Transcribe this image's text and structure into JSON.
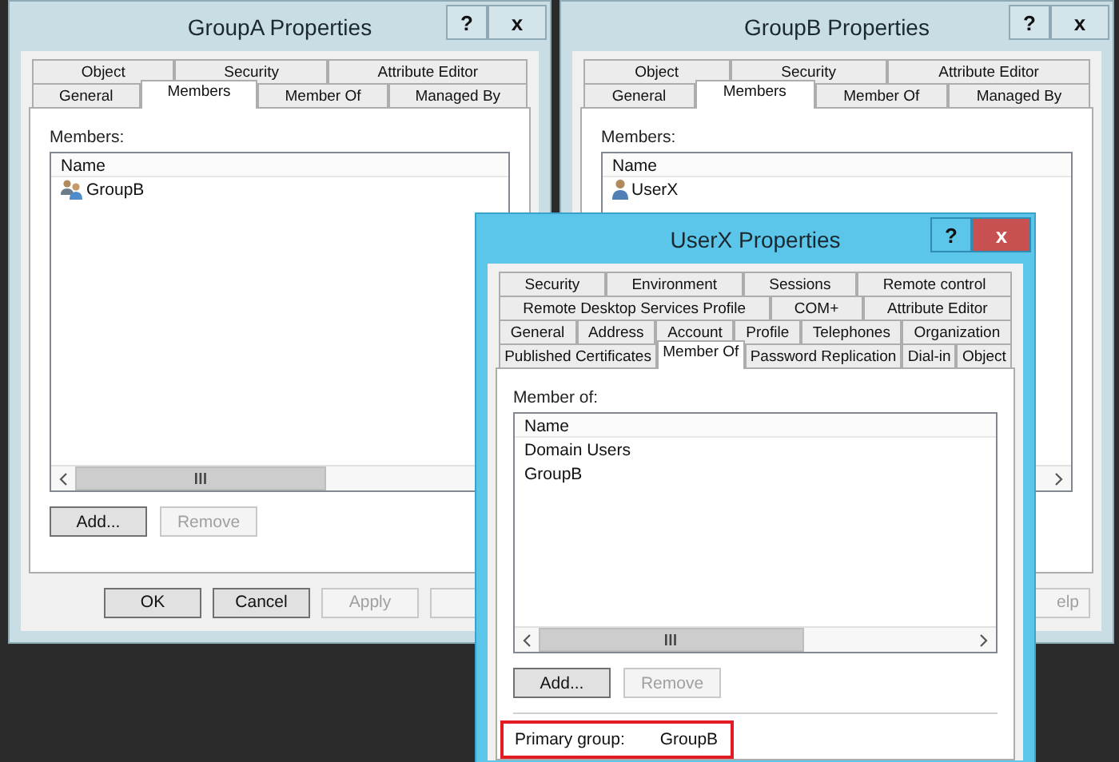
{
  "windows": [
    {
      "title": "GroupA Properties",
      "active": false,
      "caption_buttons": [
        "?",
        "x"
      ],
      "tab_rows": [
        {
          "tabs": [
            {
              "label": "Object",
              "selected": false
            },
            {
              "label": "Security",
              "selected": false
            },
            {
              "label": "Attribute Editor",
              "selected": false
            }
          ]
        },
        {
          "tabs": [
            {
              "label": "General",
              "selected": false
            },
            {
              "label": "Members",
              "selected": true
            },
            {
              "label": "Member Of",
              "selected": false
            },
            {
              "label": "Managed By",
              "selected": false
            }
          ]
        }
      ],
      "list_label": "Members:",
      "list_header": "Name",
      "list_items": [
        {
          "text": "GroupB",
          "kind": "group"
        }
      ],
      "list_buttons": [
        {
          "label": "Add...",
          "disabled": false
        },
        {
          "label": "Remove",
          "disabled": true
        }
      ],
      "footer_buttons": [
        {
          "label": "OK",
          "disabled": false
        },
        {
          "label": "Cancel",
          "disabled": false
        },
        {
          "label": "Apply",
          "disabled": true
        },
        {
          "disabled": true
        }
      ]
    },
    {
      "title": "GroupB Properties",
      "active": false,
      "caption_buttons": [
        "?",
        "x"
      ],
      "tab_rows": [
        {
          "tabs": [
            {
              "label": "Object",
              "selected": false
            },
            {
              "label": "Security",
              "selected": false
            },
            {
              "label": "Attribute Editor",
              "selected": false
            }
          ]
        },
        {
          "tabs": [
            {
              "label": "General",
              "selected": false
            },
            {
              "label": "Members",
              "selected": true
            },
            {
              "label": "Member Of",
              "selected": false
            },
            {
              "label": "Managed By",
              "selected": false
            }
          ]
        }
      ],
      "list_label": "Members:",
      "list_header": "Name",
      "list_items": [
        {
          "text": "UserX",
          "kind": "user"
        }
      ],
      "footer_buttons": [
        {
          "label": "elp",
          "disabled": true
        }
      ]
    },
    {
      "title": "UserX Properties",
      "active": true,
      "caption_buttons": [
        "?",
        "x"
      ],
      "tab_rows": [
        {
          "tabs": [
            {
              "label": "Security",
              "selected": false
            },
            {
              "label": "Environment",
              "selected": false
            },
            {
              "label": "Sessions",
              "selected": false
            },
            {
              "label": "Remote control",
              "selected": false
            }
          ]
        },
        {
          "tabs": [
            {
              "label": "Remote Desktop Services Profile",
              "selected": false
            },
            {
              "label": "COM+",
              "selected": false
            },
            {
              "label": "Attribute Editor",
              "selected": false
            }
          ]
        },
        {
          "tabs": [
            {
              "label": "General",
              "selected": false
            },
            {
              "label": "Address",
              "selected": false
            },
            {
              "label": "Account",
              "selected": false
            },
            {
              "label": "Profile",
              "selected": false
            },
            {
              "label": "Telephones",
              "selected": false
            },
            {
              "label": "Organization",
              "selected": false
            }
          ]
        },
        {
          "tabs": [
            {
              "label": "Published Certificates",
              "selected": false
            },
            {
              "label": "Member Of",
              "selected": true
            },
            {
              "label": "Password Replication",
              "selected": false
            },
            {
              "label": "Dial-in",
              "selected": false
            },
            {
              "label": "Object",
              "selected": false
            }
          ]
        }
      ],
      "list_label": "Member of:",
      "list_header": "Name",
      "list_items": [
        {
          "text": "Domain Users",
          "kind": "plain"
        },
        {
          "text": "GroupB",
          "kind": "plain"
        }
      ],
      "list_buttons": [
        {
          "label": "Add...",
          "disabled": false
        },
        {
          "label": "Remove",
          "disabled": true
        }
      ],
      "primary_group": {
        "label": "Primary group:",
        "value": "GroupB",
        "highlighted": true
      }
    }
  ]
}
